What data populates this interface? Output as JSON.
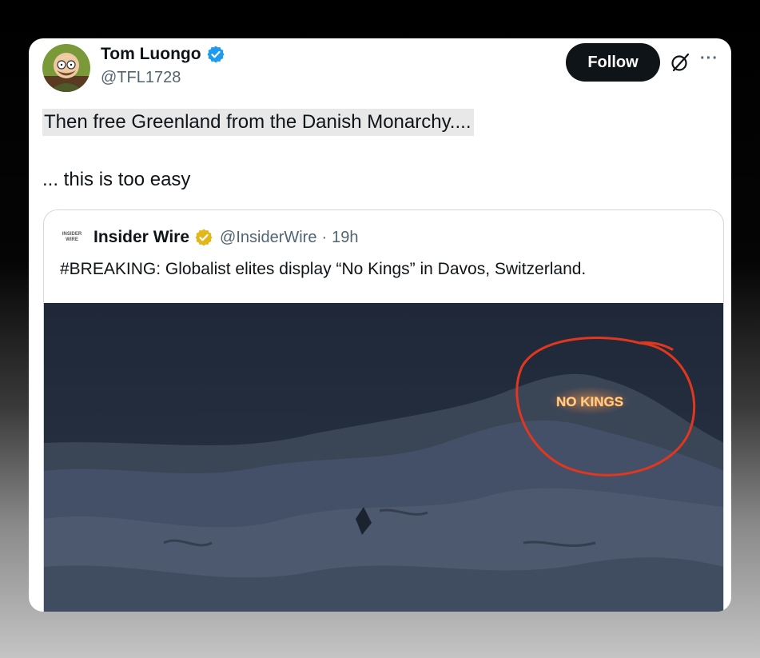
{
  "author": {
    "name": "Tom Luongo",
    "handle": "@TFL1728",
    "verified_badge": "blue-check-icon"
  },
  "actions": {
    "follow_label": "Follow",
    "grok_icon": "grok-icon",
    "more_icon": "more-icon",
    "more_label": "···"
  },
  "tweet": {
    "line1": "Then free Greenland from the Danish Monarchy....",
    "line2": "... this is too easy"
  },
  "quote": {
    "logo_top": "INSIDER",
    "logo_bottom": "WIRE",
    "name": "Insider Wire",
    "verified_badge": "gold-check-icon",
    "handle": "@InsiderWire",
    "separator": "·",
    "time": "19h",
    "text": "#BREAKING: Globalist elites display “No Kings” in Davos, Switzerland.",
    "image_caption": "NO KINGS"
  },
  "colors": {
    "follow_bg": "#0f1419",
    "verified_blue": "#1d9bf0",
    "verified_gold": "#e2b719",
    "circle_red": "#e0371e"
  }
}
